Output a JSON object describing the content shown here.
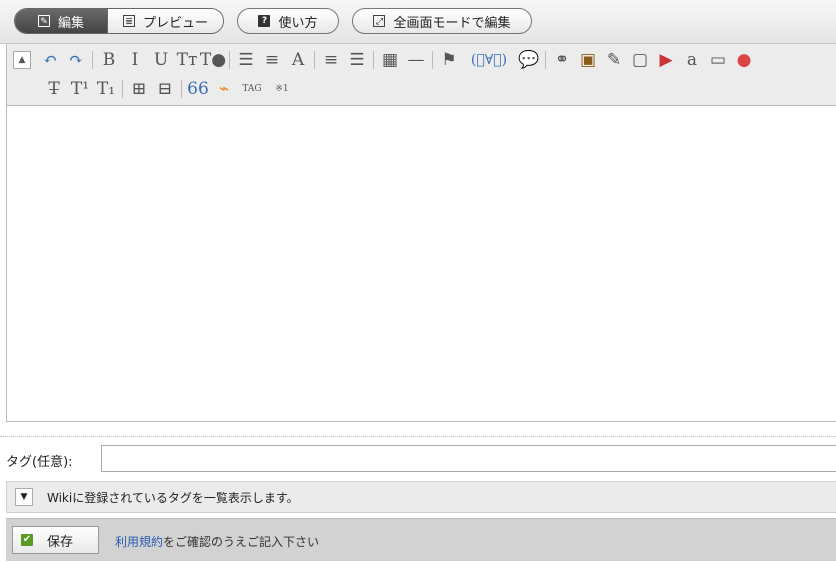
{
  "modes": {
    "edit_label": "編集",
    "preview_label": "プレビュー",
    "help_label": "使い方",
    "fullscreen_label": "全画面モードで編集"
  },
  "toolbar": {
    "row1": [
      {
        "name": "collapse-toolbar-button",
        "glyph": "▲"
      },
      {
        "name": "undo-button",
        "glyph": "↶"
      },
      {
        "name": "redo-button",
        "glyph": "↷"
      },
      {
        "name": "sep"
      },
      {
        "name": "bold-button",
        "glyph": "B"
      },
      {
        "name": "italic-button",
        "glyph": "I"
      },
      {
        "name": "underline-button",
        "glyph": "U"
      },
      {
        "name": "font-size-button",
        "glyph": "Tт"
      },
      {
        "name": "text-color-button",
        "glyph": "T●"
      },
      {
        "name": "sep"
      },
      {
        "name": "bullet-list-button",
        "glyph": "☰"
      },
      {
        "name": "numbered-list-button",
        "glyph": "≡"
      },
      {
        "name": "text-style-button",
        "glyph": "A"
      },
      {
        "name": "sep"
      },
      {
        "name": "align-center-button",
        "glyph": "≡"
      },
      {
        "name": "align-right-button",
        "glyph": "☰"
      },
      {
        "name": "sep"
      },
      {
        "name": "table-button",
        "glyph": "▦"
      },
      {
        "name": "horizontal-rule-button",
        "glyph": "—"
      },
      {
        "name": "sep"
      },
      {
        "name": "stamp-button",
        "glyph": "⚑"
      },
      {
        "name": "emoticon-button",
        "glyph": "(ﾟ∀ﾟ)"
      },
      {
        "name": "speech-bubble-button",
        "glyph": "💬"
      },
      {
        "name": "sep"
      },
      {
        "name": "link-button",
        "glyph": "⚭"
      },
      {
        "name": "image-button",
        "glyph": "▣"
      },
      {
        "name": "paint-button",
        "glyph": "✎"
      },
      {
        "name": "video-button",
        "glyph": "▢"
      },
      {
        "name": "youtube-button",
        "glyph": "▶"
      },
      {
        "name": "amazon-button",
        "glyph": "a"
      },
      {
        "name": "game-button",
        "glyph": "▭"
      },
      {
        "name": "map-pin-button",
        "glyph": "●"
      }
    ],
    "row2": [
      {
        "name": "strikethrough-button",
        "glyph": "T̶"
      },
      {
        "name": "superscript-button",
        "glyph": "T¹"
      },
      {
        "name": "subscript-button",
        "glyph": "T₁"
      },
      {
        "name": "sep"
      },
      {
        "name": "insert-before-button",
        "glyph": "⊞"
      },
      {
        "name": "insert-after-button",
        "glyph": "⊟"
      },
      {
        "name": "sep"
      },
      {
        "name": "quote-button",
        "glyph": "66"
      },
      {
        "name": "rss-button",
        "glyph": "⌁"
      },
      {
        "name": "tag-button",
        "glyph": "TAG"
      },
      {
        "name": "footnote-button",
        "glyph": "※1"
      }
    ]
  },
  "tags": {
    "label": "タグ(任意):",
    "value": "",
    "show_all_text": "Wikiに登録されているタグを一覧表示します。"
  },
  "save": {
    "button_label": "保存",
    "terms_link": "利用規約",
    "terms_note": "をご確認のうえご記入下さい"
  },
  "colors": {
    "link": "#2a5db0",
    "emoticon": "#3a6fb5",
    "quote": "#3a6fb5",
    "rss": "#e98a18",
    "save_check": "#5a9a22"
  }
}
